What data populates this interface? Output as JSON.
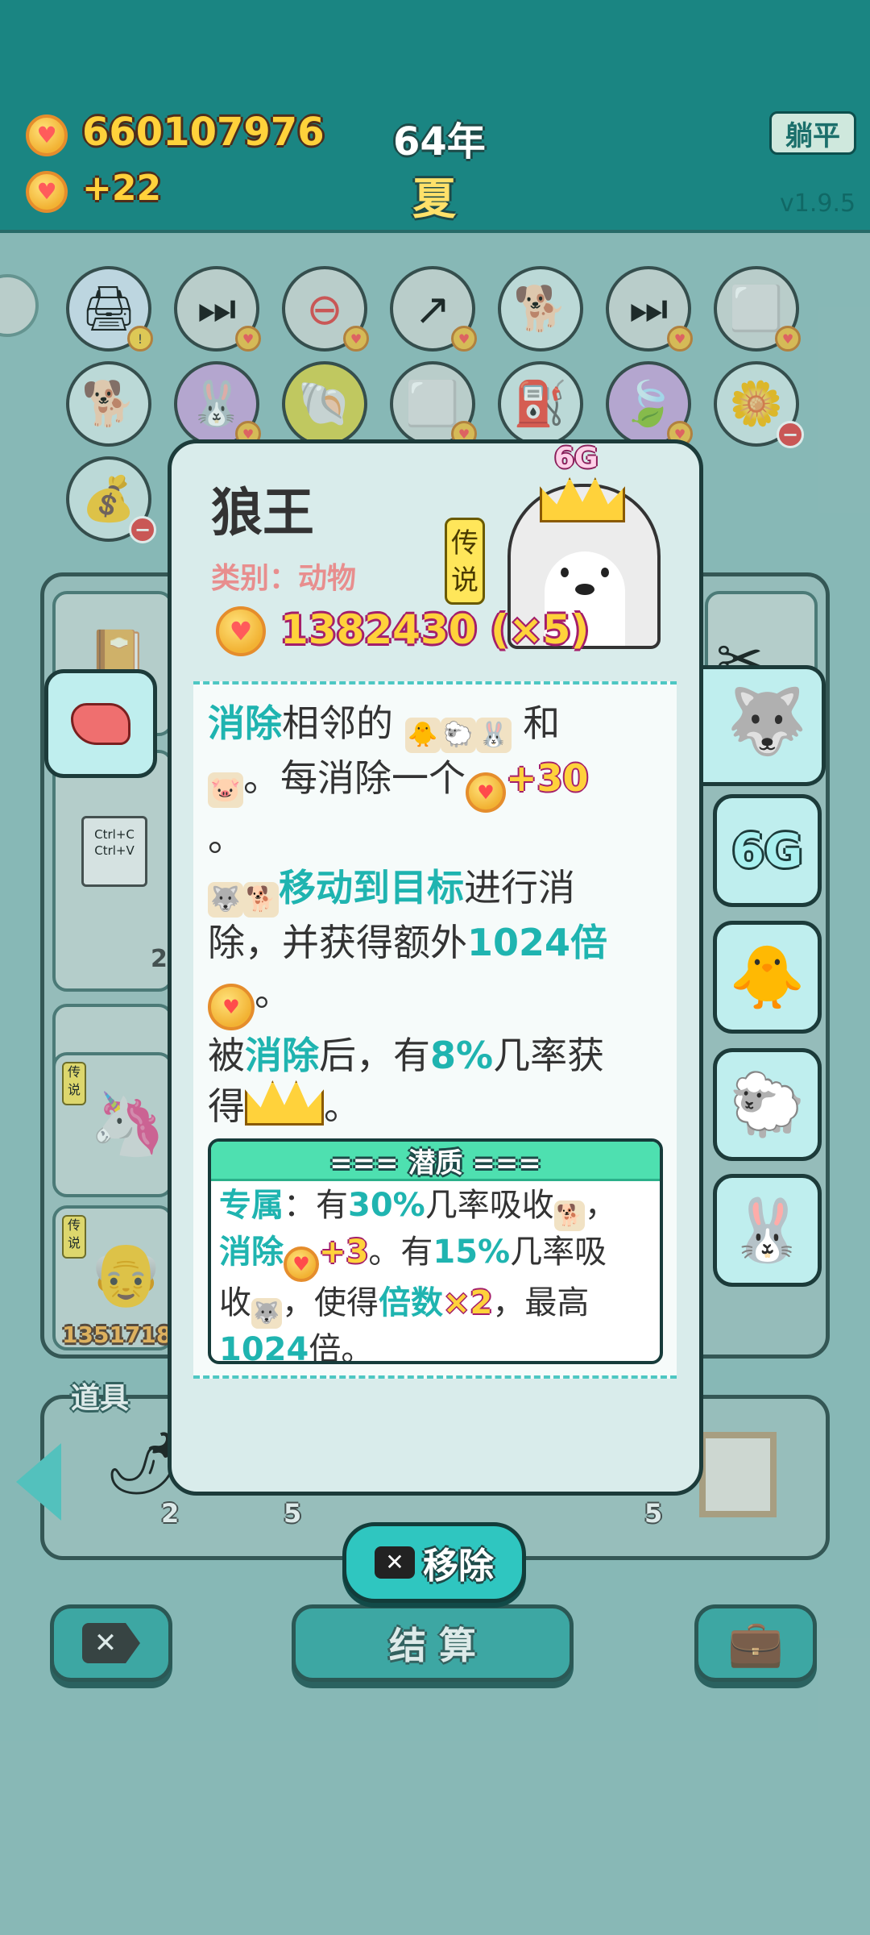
{
  "header": {
    "coins": "660107976",
    "income": "+22",
    "year": "64年",
    "season": "夏",
    "flat_button": "躺平",
    "version": "v1.9.5"
  },
  "modal": {
    "name": "狼王",
    "category": "类别：动物",
    "rarity": "传说",
    "network_badge": "6G",
    "value": "1382430 (×5)",
    "desc": {
      "l1_hl": "消除",
      "l1_a": "相邻的",
      "l1_b": "和",
      "l2_a": "。每消除一个",
      "l2_num": "+30",
      "l3": "。",
      "l4_hl": "移动到目标",
      "l4_a": "进行消",
      "l5_a": "除，并获得额外",
      "l5_hl": "1024倍",
      "l6": "。",
      "l7_a": "被",
      "l7_hl1": "消除",
      "l7_b": "后，有",
      "l7_hl2": "8%",
      "l7_c": "几率获",
      "l8_a": "得",
      "l8_b": "。"
    },
    "potential": {
      "title": "=== 潜质 ===",
      "p1_hl": "专属",
      "p1_a": "：有",
      "p1_hl2": "30%",
      "p1_b": "几率吸收",
      "p1_c": "，",
      "p2_hl": "消除",
      "p2_num": "+3",
      "p2_a": "。有",
      "p2_hl2": "15%",
      "p2_b": "几率吸",
      "p3_a": "收",
      "p3_b": "，使得",
      "p3_hl": "倍数",
      "p3_num": "×2",
      "p3_c": "，最高",
      "p4_hl": "1024",
      "p4_a": "倍。"
    },
    "remove_button": "移除"
  },
  "side_tabs": [
    "6G"
  ],
  "board": {
    "clipboard_text": "Ctrl+C\nCtrl+V",
    "card_count": "2",
    "rarity_tag": "传说",
    "partial_number": "1351718"
  },
  "tray": {
    "label": "道具",
    "counts": [
      "2",
      "5",
      "5"
    ]
  },
  "bottom": {
    "settle_button": "结 算"
  },
  "colors": {
    "top_bar": "#1a8582",
    "accent": "#1fb4b0",
    "coin": "#f2b233"
  }
}
